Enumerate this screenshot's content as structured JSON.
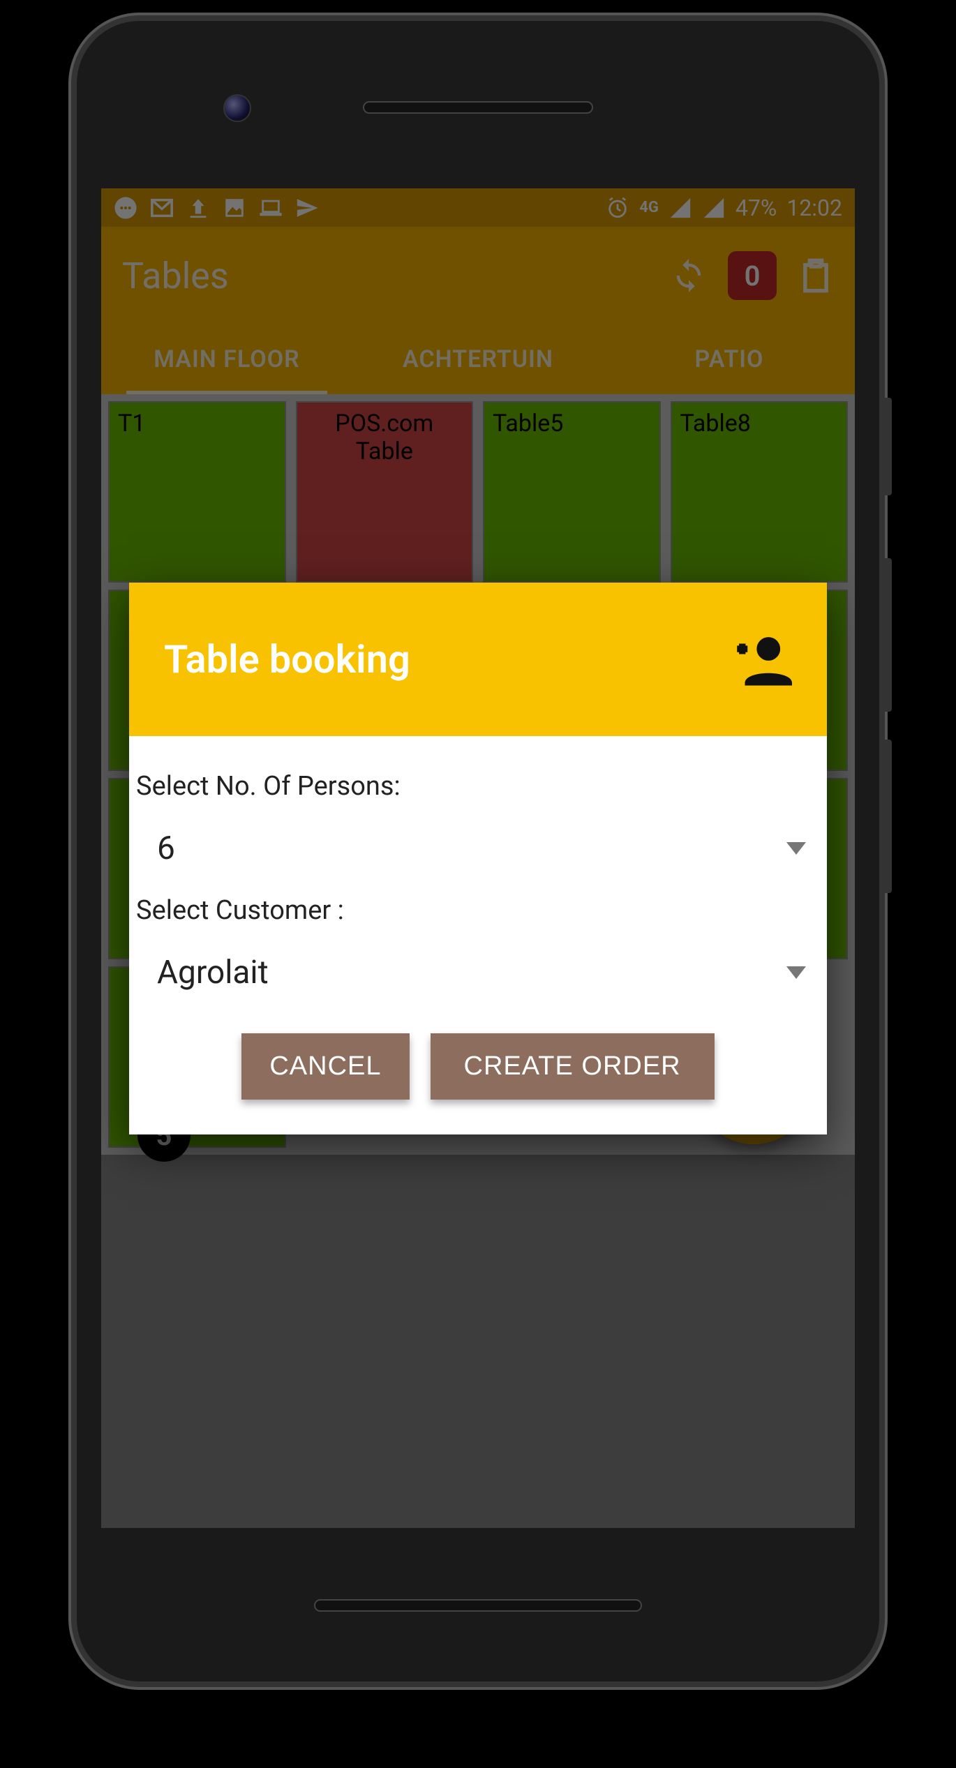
{
  "statusbar": {
    "battery": "47%",
    "time": "12:02",
    "net_label": "4G"
  },
  "appbar": {
    "title": "Tables",
    "badge_count": "0"
  },
  "tabs": [
    {
      "label": "MAIN FLOOR",
      "active": true
    },
    {
      "label": "ACHTERTUIN",
      "active": false
    },
    {
      "label": "PATIO",
      "active": false
    }
  ],
  "tables_row1": [
    {
      "label": "T1",
      "color": "green"
    },
    {
      "label": "POS.com Table",
      "color": "red"
    },
    {
      "label": "Table5",
      "color": "green"
    },
    {
      "label": "Table8",
      "color": "green"
    }
  ],
  "last_tile_badge": "5",
  "dialog": {
    "title": "Table booking",
    "persons_label": "Select No. Of Persons:",
    "persons_value": "6",
    "customer_label": "Select Customer :",
    "customer_value": "Agrolait",
    "cancel": "CANCEL",
    "create": "CREATE ORDER"
  }
}
